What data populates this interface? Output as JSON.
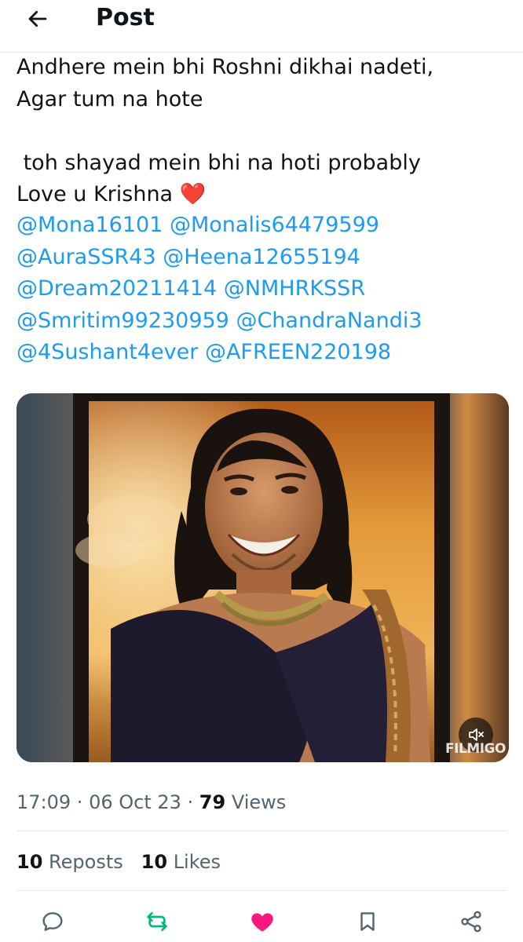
{
  "header": {
    "title": "Post",
    "back_icon": "arrow-left-icon"
  },
  "tweet": {
    "lines": [
      "Andhere mein bhi Roshni dikhai nadeti,",
      "Agar tum na hote",
      "",
      " toh shayad mein bhi na hoti probably",
      "Love u Krishna"
    ],
    "emoji": "❤️",
    "mention_lines": [
      [
        "@Mona16101",
        "@Monalis64479599"
      ],
      [
        "@AuraSSR43",
        "@Heena12655194"
      ],
      [
        "@Dream20211414",
        "@NMHRKSSR"
      ],
      [
        "@Smritim99230959",
        "@ChandraNandi3"
      ],
      [
        "@4Sushant4ever",
        "@AFREEN220198"
      ]
    ]
  },
  "media": {
    "watermark": "FILMIGO",
    "mute_icon": "speaker-muted-icon"
  },
  "meta": {
    "time": "17:09",
    "date": "06 Oct 23",
    "views_count": "79",
    "views_label": "Views"
  },
  "stats": {
    "reposts_count": "10",
    "reposts_label": "Reposts",
    "likes_count": "10",
    "likes_label": "Likes"
  },
  "actions": {
    "reply": "reply-icon",
    "repost": "repost-icon",
    "like": "heart-icon",
    "bookmark": "bookmark-icon",
    "share": "share-icon"
  },
  "colors": {
    "link": "#1d9bf0",
    "repost_active": "#00ba7c",
    "like_active": "#f91880",
    "muted_text": "#536471"
  }
}
